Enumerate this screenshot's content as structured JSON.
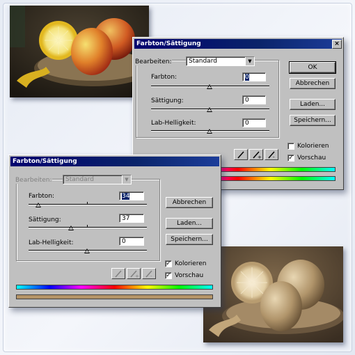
{
  "colors": {
    "titlebar": "#0a246a",
    "dialog_bg": "#c0c0c0",
    "sepia_bar": "#b49468"
  },
  "dialog_back": {
    "title": "Farbton/Sättigung",
    "edit_label": "Bearbeiten:",
    "edit_value": "Standard",
    "hue_label": "Farbton:",
    "hue_value": "0",
    "saturation_label": "Sättigung:",
    "saturation_value": "0",
    "lightness_label": "Lab-Helligkeit:",
    "lightness_value": "0",
    "ok": "OK",
    "cancel": "Abbrechen",
    "load": "Laden...",
    "save": "Speichern...",
    "colorize": "Kolorieren",
    "preview": "Vorschau",
    "colorize_checked": false,
    "preview_checked": true,
    "close_glyph": "×"
  },
  "dialog_front": {
    "title": "Farbton/Sättigung",
    "edit_label": "Bearbeiten:",
    "edit_value": "Standard",
    "hue_label": "Farbton:",
    "hue_value": "34",
    "saturation_label": "Sättigung:",
    "saturation_value": "37",
    "lightness_label": "Lab-Helligkeit:",
    "lightness_value": "0",
    "cancel": "Abbrechen",
    "load": "Laden...",
    "save": "Speichern...",
    "colorize": "Kolorieren",
    "preview": "Vorschau",
    "colorize_checked": true,
    "preview_checked": true,
    "check_glyph": "✓"
  }
}
